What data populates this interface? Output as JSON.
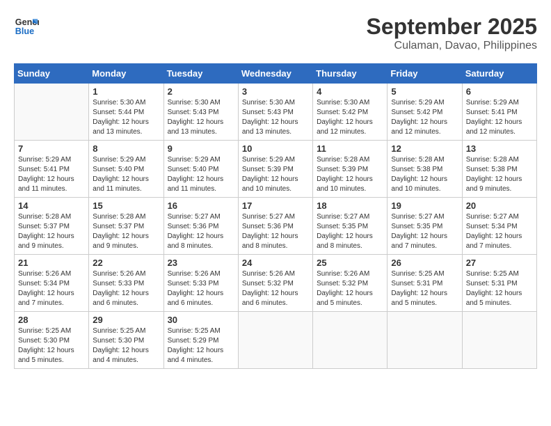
{
  "logo": {
    "text_general": "General",
    "text_blue": "Blue"
  },
  "title": "September 2025",
  "subtitle": "Culaman, Davao, Philippines",
  "days_of_week": [
    "Sunday",
    "Monday",
    "Tuesday",
    "Wednesday",
    "Thursday",
    "Friday",
    "Saturday"
  ],
  "weeks": [
    [
      {
        "day": "",
        "sunrise": "",
        "sunset": "",
        "daylight": ""
      },
      {
        "day": "1",
        "sunrise": "Sunrise: 5:30 AM",
        "sunset": "Sunset: 5:44 PM",
        "daylight": "Daylight: 12 hours and 13 minutes."
      },
      {
        "day": "2",
        "sunrise": "Sunrise: 5:30 AM",
        "sunset": "Sunset: 5:43 PM",
        "daylight": "Daylight: 12 hours and 13 minutes."
      },
      {
        "day": "3",
        "sunrise": "Sunrise: 5:30 AM",
        "sunset": "Sunset: 5:43 PM",
        "daylight": "Daylight: 12 hours and 13 minutes."
      },
      {
        "day": "4",
        "sunrise": "Sunrise: 5:30 AM",
        "sunset": "Sunset: 5:42 PM",
        "daylight": "Daylight: 12 hours and 12 minutes."
      },
      {
        "day": "5",
        "sunrise": "Sunrise: 5:29 AM",
        "sunset": "Sunset: 5:42 PM",
        "daylight": "Daylight: 12 hours and 12 minutes."
      },
      {
        "day": "6",
        "sunrise": "Sunrise: 5:29 AM",
        "sunset": "Sunset: 5:41 PM",
        "daylight": "Daylight: 12 hours and 12 minutes."
      }
    ],
    [
      {
        "day": "7",
        "sunrise": "Sunrise: 5:29 AM",
        "sunset": "Sunset: 5:41 PM",
        "daylight": "Daylight: 12 hours and 11 minutes."
      },
      {
        "day": "8",
        "sunrise": "Sunrise: 5:29 AM",
        "sunset": "Sunset: 5:40 PM",
        "daylight": "Daylight: 12 hours and 11 minutes."
      },
      {
        "day": "9",
        "sunrise": "Sunrise: 5:29 AM",
        "sunset": "Sunset: 5:40 PM",
        "daylight": "Daylight: 12 hours and 11 minutes."
      },
      {
        "day": "10",
        "sunrise": "Sunrise: 5:29 AM",
        "sunset": "Sunset: 5:39 PM",
        "daylight": "Daylight: 12 hours and 10 minutes."
      },
      {
        "day": "11",
        "sunrise": "Sunrise: 5:28 AM",
        "sunset": "Sunset: 5:39 PM",
        "daylight": "Daylight: 12 hours and 10 minutes."
      },
      {
        "day": "12",
        "sunrise": "Sunrise: 5:28 AM",
        "sunset": "Sunset: 5:38 PM",
        "daylight": "Daylight: 12 hours and 10 minutes."
      },
      {
        "day": "13",
        "sunrise": "Sunrise: 5:28 AM",
        "sunset": "Sunset: 5:38 PM",
        "daylight": "Daylight: 12 hours and 9 minutes."
      }
    ],
    [
      {
        "day": "14",
        "sunrise": "Sunrise: 5:28 AM",
        "sunset": "Sunset: 5:37 PM",
        "daylight": "Daylight: 12 hours and 9 minutes."
      },
      {
        "day": "15",
        "sunrise": "Sunrise: 5:28 AM",
        "sunset": "Sunset: 5:37 PM",
        "daylight": "Daylight: 12 hours and 9 minutes."
      },
      {
        "day": "16",
        "sunrise": "Sunrise: 5:27 AM",
        "sunset": "Sunset: 5:36 PM",
        "daylight": "Daylight: 12 hours and 8 minutes."
      },
      {
        "day": "17",
        "sunrise": "Sunrise: 5:27 AM",
        "sunset": "Sunset: 5:36 PM",
        "daylight": "Daylight: 12 hours and 8 minutes."
      },
      {
        "day": "18",
        "sunrise": "Sunrise: 5:27 AM",
        "sunset": "Sunset: 5:35 PM",
        "daylight": "Daylight: 12 hours and 8 minutes."
      },
      {
        "day": "19",
        "sunrise": "Sunrise: 5:27 AM",
        "sunset": "Sunset: 5:35 PM",
        "daylight": "Daylight: 12 hours and 7 minutes."
      },
      {
        "day": "20",
        "sunrise": "Sunrise: 5:27 AM",
        "sunset": "Sunset: 5:34 PM",
        "daylight": "Daylight: 12 hours and 7 minutes."
      }
    ],
    [
      {
        "day": "21",
        "sunrise": "Sunrise: 5:26 AM",
        "sunset": "Sunset: 5:34 PM",
        "daylight": "Daylight: 12 hours and 7 minutes."
      },
      {
        "day": "22",
        "sunrise": "Sunrise: 5:26 AM",
        "sunset": "Sunset: 5:33 PM",
        "daylight": "Daylight: 12 hours and 6 minutes."
      },
      {
        "day": "23",
        "sunrise": "Sunrise: 5:26 AM",
        "sunset": "Sunset: 5:33 PM",
        "daylight": "Daylight: 12 hours and 6 minutes."
      },
      {
        "day": "24",
        "sunrise": "Sunrise: 5:26 AM",
        "sunset": "Sunset: 5:32 PM",
        "daylight": "Daylight: 12 hours and 6 minutes."
      },
      {
        "day": "25",
        "sunrise": "Sunrise: 5:26 AM",
        "sunset": "Sunset: 5:32 PM",
        "daylight": "Daylight: 12 hours and 5 minutes."
      },
      {
        "day": "26",
        "sunrise": "Sunrise: 5:25 AM",
        "sunset": "Sunset: 5:31 PM",
        "daylight": "Daylight: 12 hours and 5 minutes."
      },
      {
        "day": "27",
        "sunrise": "Sunrise: 5:25 AM",
        "sunset": "Sunset: 5:31 PM",
        "daylight": "Daylight: 12 hours and 5 minutes."
      }
    ],
    [
      {
        "day": "28",
        "sunrise": "Sunrise: 5:25 AM",
        "sunset": "Sunset: 5:30 PM",
        "daylight": "Daylight: 12 hours and 5 minutes."
      },
      {
        "day": "29",
        "sunrise": "Sunrise: 5:25 AM",
        "sunset": "Sunset: 5:30 PM",
        "daylight": "Daylight: 12 hours and 4 minutes."
      },
      {
        "day": "30",
        "sunrise": "Sunrise: 5:25 AM",
        "sunset": "Sunset: 5:29 PM",
        "daylight": "Daylight: 12 hours and 4 minutes."
      },
      {
        "day": "",
        "sunrise": "",
        "sunset": "",
        "daylight": ""
      },
      {
        "day": "",
        "sunrise": "",
        "sunset": "",
        "daylight": ""
      },
      {
        "day": "",
        "sunrise": "",
        "sunset": "",
        "daylight": ""
      },
      {
        "day": "",
        "sunrise": "",
        "sunset": "",
        "daylight": ""
      }
    ]
  ]
}
